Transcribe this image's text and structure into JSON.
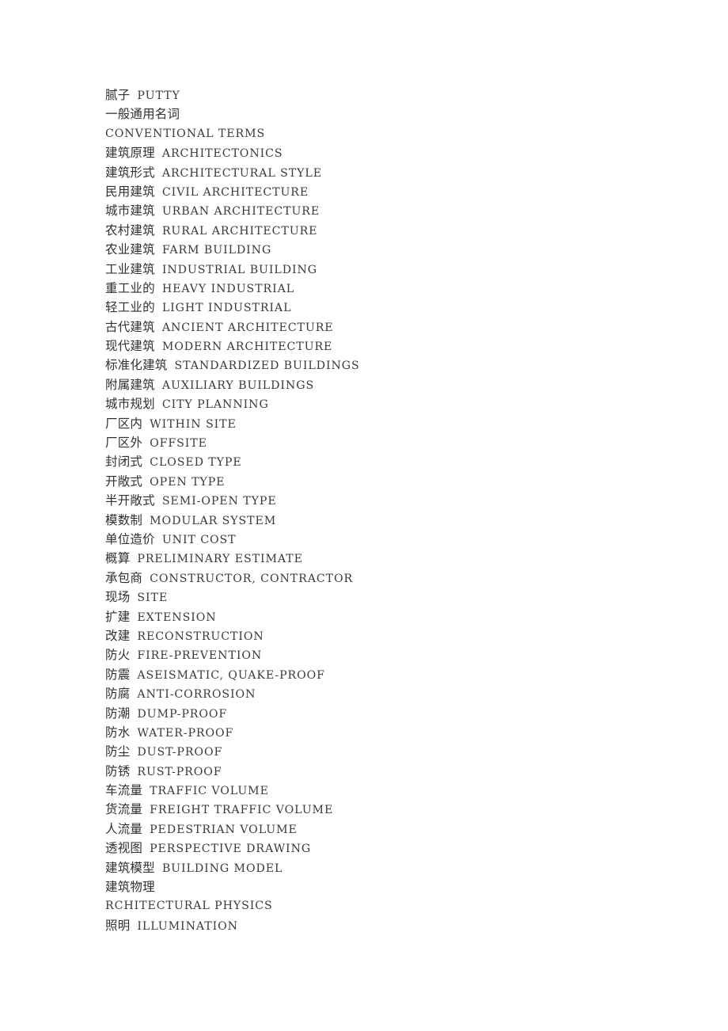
{
  "document": {
    "background_color": "#ffffff",
    "text_color": "#303030",
    "title_visible": false
  },
  "glossary": {
    "entries": [
      {
        "zh": "腻子",
        "en": "PUTTY",
        "kind": "pair"
      },
      {
        "zh": "一般通用名词",
        "en": "",
        "kind": "zh-only"
      },
      {
        "zh": "",
        "en": "CONVENTIONAL TERMS",
        "kind": "en-only"
      },
      {
        "zh": "建筑原理",
        "en": "ARCHITECTONICS",
        "kind": "pair"
      },
      {
        "zh": "建筑形式",
        "en": "ARCHITECTURAL STYLE",
        "kind": "pair"
      },
      {
        "zh": "民用建筑",
        "en": "CIVIL ARCHITECTURE",
        "kind": "pair"
      },
      {
        "zh": "城市建筑",
        "en": "URBAN ARCHITECTURE",
        "kind": "pair"
      },
      {
        "zh": "农村建筑",
        "en": "RURAL ARCHITECTURE",
        "kind": "pair"
      },
      {
        "zh": "农业建筑",
        "en": "FARM BUILDING",
        "kind": "pair"
      },
      {
        "zh": "工业建筑",
        "en": "INDUSTRIAL BUILDING",
        "kind": "pair"
      },
      {
        "zh": "重工业的",
        "en": "HEAVY INDUSTRIAL",
        "kind": "pair"
      },
      {
        "zh": "轻工业的",
        "en": "LIGHT INDUSTRIAL",
        "kind": "pair"
      },
      {
        "zh": "古代建筑",
        "en": "ANCIENT ARCHITECTURE",
        "kind": "pair"
      },
      {
        "zh": "现代建筑",
        "en": "MODERN ARCHITECTURE",
        "kind": "pair"
      },
      {
        "zh": "标准化建筑",
        "en": "STANDARDIZED BUILDINGS",
        "kind": "pair"
      },
      {
        "zh": "附属建筑",
        "en": "AUXILIARY BUILDINGS",
        "kind": "pair"
      },
      {
        "zh": "城市规划",
        "en": "CITY PLANNING",
        "kind": "pair"
      },
      {
        "zh": "厂区内",
        "en": "WITHIN SITE",
        "kind": "pair"
      },
      {
        "zh": "厂区外",
        "en": "OFFSITE",
        "kind": "pair"
      },
      {
        "zh": "封闭式",
        "en": "CLOSED TYPE",
        "kind": "pair"
      },
      {
        "zh": "开敞式",
        "en": "OPEN TYPE",
        "kind": "pair"
      },
      {
        "zh": "半开敞式",
        "en": "SEMI-OPEN TYPE",
        "kind": "pair"
      },
      {
        "zh": "模数制",
        "en": "MODULAR SYSTEM",
        "kind": "pair"
      },
      {
        "zh": "单位造价",
        "en": "UNIT COST",
        "kind": "pair"
      },
      {
        "zh": "概算",
        "en": "PRELIMINARY ESTIMATE",
        "kind": "pair"
      },
      {
        "zh": "承包商",
        "en": "CONSTRUCTOR, CONTRACTOR",
        "kind": "pair"
      },
      {
        "zh": "现场",
        "en": "SITE",
        "kind": "pair"
      },
      {
        "zh": "扩建",
        "en": "EXTENSION",
        "kind": "pair"
      },
      {
        "zh": "改建",
        "en": "RECONSTRUCTION",
        "kind": "pair"
      },
      {
        "zh": "防火",
        "en": "FIRE-PREVENTION",
        "kind": "pair"
      },
      {
        "zh": "防震",
        "en": "ASEISMATIC, QUAKE-PROOF",
        "kind": "pair"
      },
      {
        "zh": "防腐",
        "en": "ANTI-CORROSION",
        "kind": "pair"
      },
      {
        "zh": "防潮",
        "en": "DUMP-PROOF",
        "kind": "pair"
      },
      {
        "zh": "防水",
        "en": "WATER-PROOF",
        "kind": "pair"
      },
      {
        "zh": "防尘",
        "en": "DUST-PROOF",
        "kind": "pair"
      },
      {
        "zh": "防锈",
        "en": "RUST-PROOF",
        "kind": "pair"
      },
      {
        "zh": "车流量",
        "en": "TRAFFIC VOLUME",
        "kind": "pair"
      },
      {
        "zh": "货流量",
        "en": "FREIGHT TRAFFIC VOLUME",
        "kind": "pair"
      },
      {
        "zh": "人流量",
        "en": "PEDESTRIAN VOLUME",
        "kind": "pair"
      },
      {
        "zh": "透视图",
        "en": "PERSPECTIVE DRAWING",
        "kind": "pair"
      },
      {
        "zh": "建筑模型",
        "en": "BUILDING MODEL",
        "kind": "pair"
      },
      {
        "zh": "建筑物理",
        "en": "",
        "kind": "zh-only"
      },
      {
        "zh": "",
        "en": "RCHITECTURAL PHYSICS",
        "kind": "en-only"
      },
      {
        "zh": "照明",
        "en": "ILLUMINATION",
        "kind": "pair"
      }
    ]
  }
}
